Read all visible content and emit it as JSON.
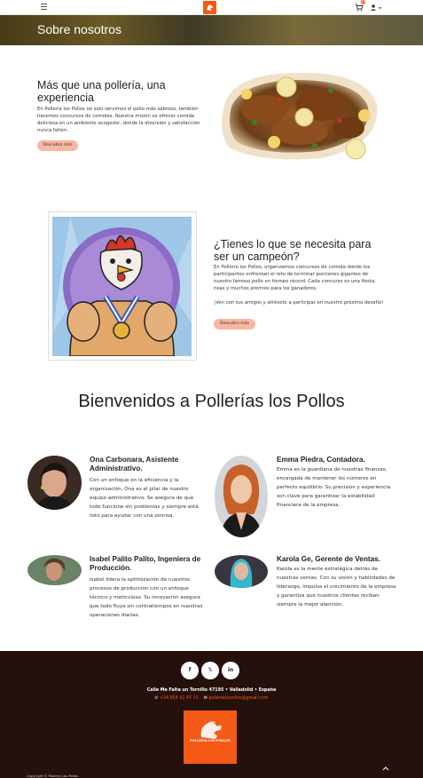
{
  "colors": {
    "accent": "#f45a16",
    "button": "#f8b7a0",
    "footer_bg": "#25100b"
  },
  "nav": {
    "cart_count": "0"
  },
  "hero": {
    "title": "Sobre nosotros"
  },
  "section1": {
    "title": "Más que una pollería, una experiencia",
    "text": "En Pollería los Pollos no solo servimos el pollo más sabroso, también hacemos concursos de comidas. Nuestra misión es ofrecer comida deliciosa en un ambiente acogedor, donde la diversión y satisfacción nunca falten.",
    "button": "Descubra más"
  },
  "section2": {
    "title": "¿Tienes lo que se necesita para ser un campeón?",
    "text": "En Pollería los Pollos, organizamos concursos de comida donde los participantes enfrentan el reto de terminar porciones gigantes de nuestro famoso pollo en tiempo récord. Cada concurso es una fiesta, risas y muchos premios para los ganadores.",
    "text2": "¡Ven con tus amigos y atrévete a participar en nuestro próximo desafío!",
    "button": "Descubra más"
  },
  "welcome": {
    "title": "Bienvenidos a Pollerías los Pollos"
  },
  "team": [
    {
      "name": "Ona Carbonara, Asistente Administrativo.",
      "bio": "Con un enfoque en la eficiencia y la organización, Ona es el pilar de nuestro equipo administrativo. Se asegura de que todo funcione sin problemas y siempre está listo para ayudar con una sonrisa."
    },
    {
      "name": "Emma Piedra, Contadora.",
      "bio": "Emma es la guardiana de nuestras finanzas, encargada de mantener los números en perfecto equilibrio. Su precisión y experiencia son clave para garantizar la estabilidad financiera de la empresa."
    },
    {
      "name": "Isabel Palito Palito, Ingeniera de Producción.",
      "bio": "Isabel lidera la optimización de nuestros procesos de producción con un enfoque técnico y meticuloso. Su innovación asegura que todo fluya sin contratiempos en nuestras operaciones diarias."
    },
    {
      "name": "Karola Ge, Gerente de Ventas.",
      "bio": "Karola es la mente estratégica detrás de nuestras ventas. Con su visión y habilidades de liderazgo, impulsa el crecimiento de la empresa y garantiza que nuestros clientes reciban siempre la mejor atención."
    }
  ],
  "footer": {
    "social": [
      "f",
      "𝕏",
      "in"
    ],
    "address": "Calle Me Falta un Tornillo 47195 • Valladolid • España",
    "phone": "+34 658 91 47 15",
    "email": "polleriaospollos@gmail.com",
    "logo_text": "POLLERIA LOS POLLOS",
    "copyright": "Copyright © Pollería Los Pollos"
  }
}
